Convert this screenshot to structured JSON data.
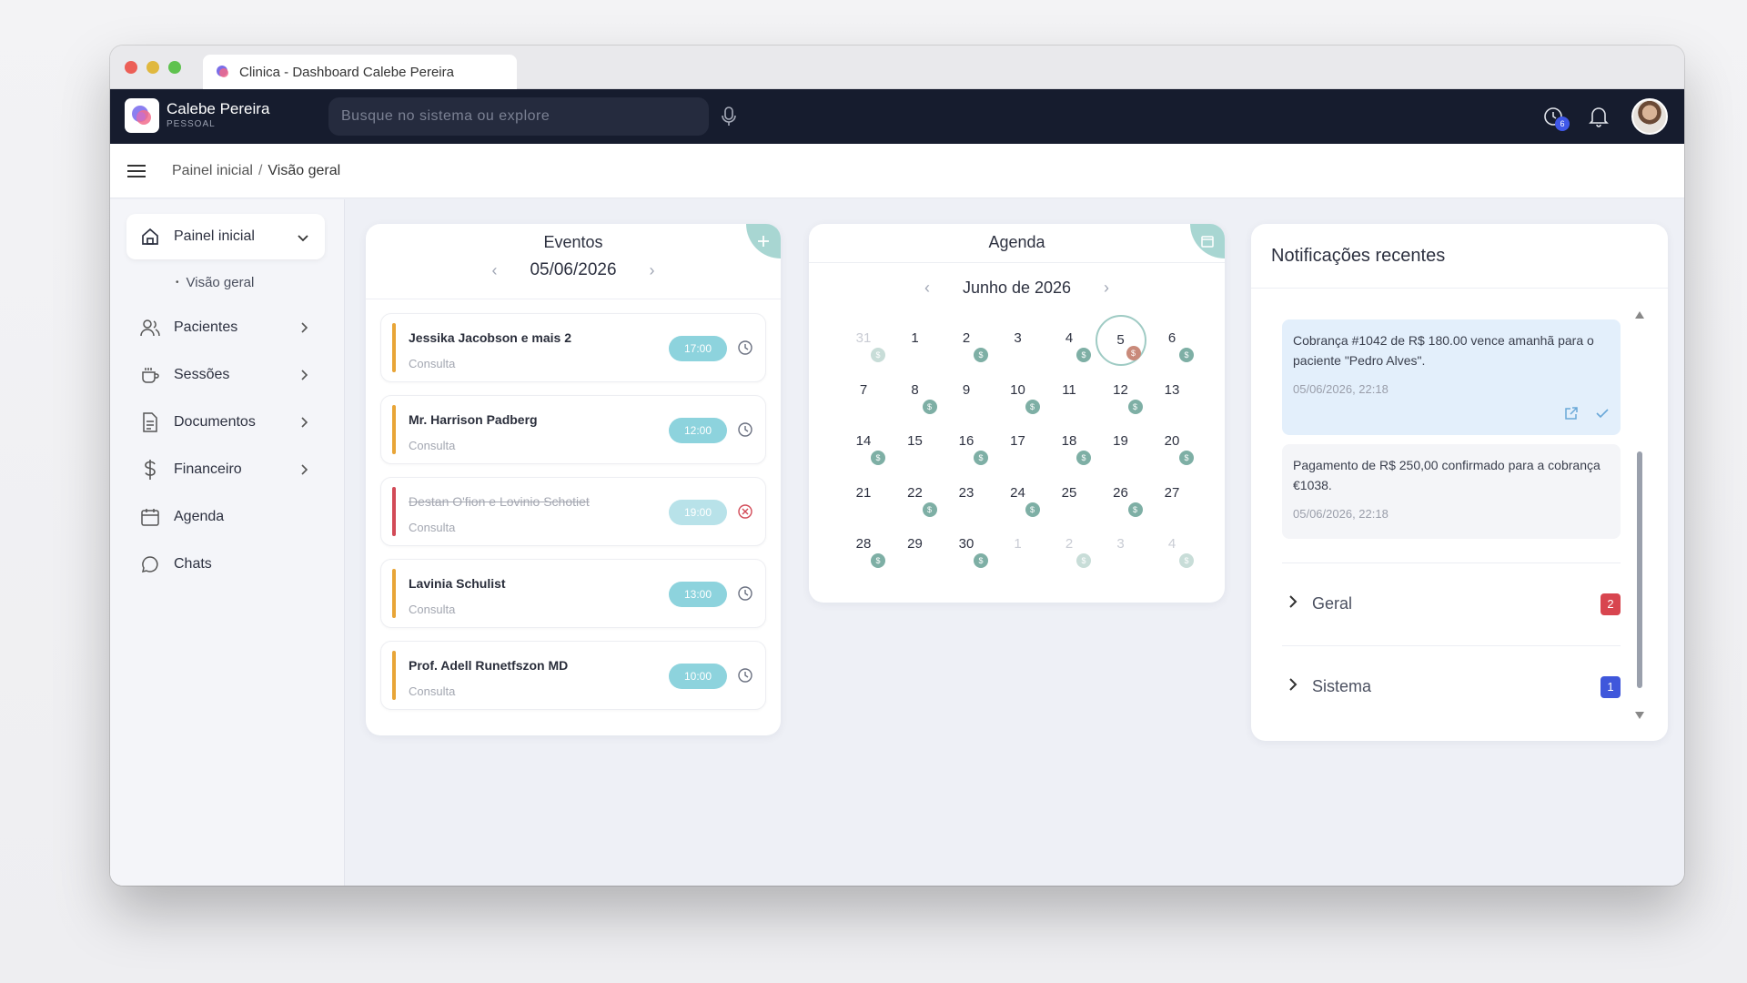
{
  "window": {
    "tab_title": "Clinica - Dashboard Calebe Pereira"
  },
  "appbar": {
    "user_name": "Calebe Pereira",
    "user_subtitle": "PESSOAL",
    "search_placeholder": "Busque no sistema ou explore",
    "history_count": "6"
  },
  "breadcrumb": {
    "root": "Painel inicial",
    "separator": "/",
    "current": "Visão geral"
  },
  "sidebar": {
    "items": [
      {
        "label": "Painel inicial"
      },
      {
        "label": "Visão geral"
      },
      {
        "label": "Pacientes"
      },
      {
        "label": "Sessões"
      },
      {
        "label": "Documentos"
      },
      {
        "label": "Financeiro"
      },
      {
        "label": "Agenda"
      },
      {
        "label": "Chats"
      }
    ]
  },
  "events": {
    "title": "Eventos",
    "date": "05/06/2026",
    "items": [
      {
        "name": "Jessika Jacobson e mais 2",
        "type": "Consulta",
        "time": "17:00",
        "status": "scheduled"
      },
      {
        "name": "Mr. Harrison Padberg",
        "type": "Consulta",
        "time": "12:00",
        "status": "scheduled"
      },
      {
        "name": "Destan O'fion e Lovinio Schotiet",
        "type": "Consulta",
        "time": "19:00",
        "status": "cancelled"
      },
      {
        "name": "Lavinia Schulist",
        "type": "Consulta",
        "time": "13:00",
        "status": "scheduled"
      },
      {
        "name": "Prof. Adell Runetfszon MD",
        "type": "Consulta",
        "time": "10:00",
        "status": "scheduled"
      }
    ]
  },
  "agenda": {
    "title": "Agenda",
    "month": "Junho de 2026",
    "dot_symbol": "$",
    "days": [
      {
        "d": "31",
        "muted": true,
        "dot": true
      },
      {
        "d": "1",
        "muted": false,
        "dot": false
      },
      {
        "d": "2",
        "muted": false,
        "dot": true
      },
      {
        "d": "3",
        "muted": false,
        "dot": false
      },
      {
        "d": "4",
        "muted": false,
        "dot": true
      },
      {
        "d": "5",
        "muted": false,
        "dot": true,
        "today": true
      },
      {
        "d": "6",
        "muted": false,
        "dot": true
      },
      {
        "d": "7",
        "muted": false,
        "dot": false
      },
      {
        "d": "8",
        "muted": false,
        "dot": true
      },
      {
        "d": "9",
        "muted": false,
        "dot": false
      },
      {
        "d": "10",
        "muted": false,
        "dot": true
      },
      {
        "d": "11",
        "muted": false,
        "dot": false
      },
      {
        "d": "12",
        "muted": false,
        "dot": true
      },
      {
        "d": "13",
        "muted": false,
        "dot": false
      },
      {
        "d": "14",
        "muted": false,
        "dot": true
      },
      {
        "d": "15",
        "muted": false,
        "dot": false
      },
      {
        "d": "16",
        "muted": false,
        "dot": true
      },
      {
        "d": "17",
        "muted": false,
        "dot": false
      },
      {
        "d": "18",
        "muted": false,
        "dot": true
      },
      {
        "d": "19",
        "muted": false,
        "dot": false
      },
      {
        "d": "20",
        "muted": false,
        "dot": true
      },
      {
        "d": "21",
        "muted": false,
        "dot": false
      },
      {
        "d": "22",
        "muted": false,
        "dot": true
      },
      {
        "d": "23",
        "muted": false,
        "dot": false
      },
      {
        "d": "24",
        "muted": false,
        "dot": true
      },
      {
        "d": "25",
        "muted": false,
        "dot": false
      },
      {
        "d": "26",
        "muted": false,
        "dot": true
      },
      {
        "d": "27",
        "muted": false,
        "dot": false
      },
      {
        "d": "28",
        "muted": false,
        "dot": true
      },
      {
        "d": "29",
        "muted": false,
        "dot": false
      },
      {
        "d": "30",
        "muted": false,
        "dot": true
      },
      {
        "d": "1",
        "muted": true,
        "dot": false
      },
      {
        "d": "2",
        "muted": true,
        "dot": true
      },
      {
        "d": "3",
        "muted": true,
        "dot": false
      },
      {
        "d": "4",
        "muted": true,
        "dot": true
      }
    ]
  },
  "notifications": {
    "title": "Notificações recentes",
    "items": [
      {
        "text": "Cobrança #1042 de R$ 180.00 vence amanhã para o paciente \"Pedro Alves\".",
        "date": "05/06/2026, 22:18",
        "state": "new"
      },
      {
        "text": "Pagamento de R$ 250,00 confirmado para a cobrança €1038.",
        "date": "05/06/2026, 22:18",
        "state": "read"
      }
    ],
    "groups": [
      {
        "label": "Geral",
        "count": "2",
        "color": "#d8454f"
      },
      {
        "label": "Sistema",
        "count": "1",
        "color": "#3f57db"
      }
    ]
  },
  "colors": {
    "accent_teal": "#8dd3dd",
    "appbar_bg": "#161c2e",
    "event_bar": "#e8a537",
    "event_cancelled": "#d24a57"
  }
}
